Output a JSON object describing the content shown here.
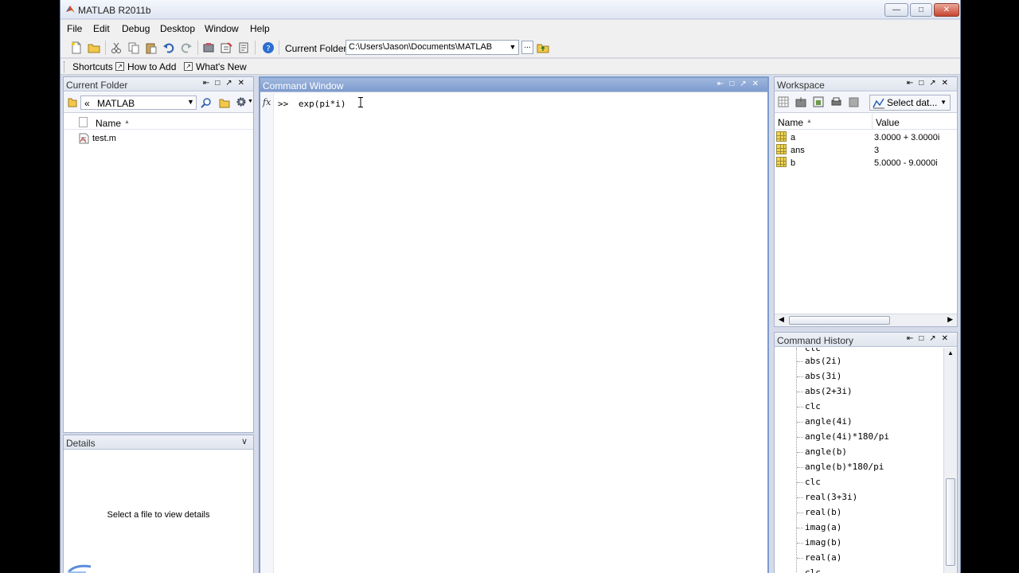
{
  "window": {
    "title": "MATLAB  R2011b"
  },
  "menu": [
    "File",
    "Edit",
    "Debug",
    "Desktop",
    "Window",
    "Help"
  ],
  "toolbar": {
    "current_folder_label": "Current Folder:",
    "current_folder_path": "C:\\Users\\Jason\\Documents\\MATLAB",
    "browse_label": "..."
  },
  "shortcuts": {
    "label": "Shortcuts",
    "items": [
      "How to Add",
      "What's New"
    ]
  },
  "current_folder_panel": {
    "title": "Current Folder",
    "path_prefix": "«",
    "path": "MATLAB",
    "column_name": "Name",
    "sort_indicator": "▲",
    "files": [
      "test.m"
    ]
  },
  "details_panel": {
    "title": "Details",
    "message": "Select a file to view details"
  },
  "command_window": {
    "title": "Command Window",
    "fx": "fx",
    "prompt": ">>",
    "input": "exp(pi*i)"
  },
  "workspace": {
    "title": "Workspace",
    "select_label": "Select dat...",
    "columns": {
      "name": "Name",
      "value": "Value"
    },
    "sort_indicator": "▲",
    "variables": [
      {
        "name": "a",
        "value": "3.0000 + 3.0000i"
      },
      {
        "name": "ans",
        "value": "3"
      },
      {
        "name": "b",
        "value": "5.0000 - 9.0000i"
      }
    ]
  },
  "command_history": {
    "title": "Command History",
    "partial_top": "clc",
    "entries": [
      "abs(2i)",
      "abs(3i)",
      "abs(2+3i)",
      "clc",
      "angle(4i)",
      "angle(4i)*180/pi",
      "angle(b)",
      "angle(b)*180/pi",
      "clc",
      "real(3+3i)",
      "real(b)",
      "imag(a)",
      "imag(b)",
      "real(a)"
    ],
    "partial_bottom": "clc"
  },
  "colors": {
    "active_header": "#7d9bcf",
    "chrome": "#d6dbe9",
    "variable_icon": "#f4d64a"
  }
}
